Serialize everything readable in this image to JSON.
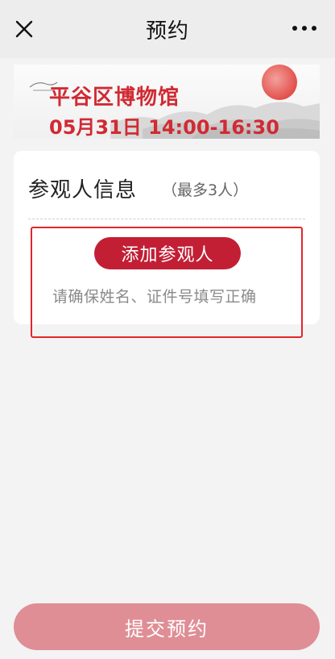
{
  "header": {
    "title": "预约",
    "close_icon": "close-icon",
    "more_icon": "more-icon"
  },
  "banner": {
    "museum_name": "平谷区博物馆",
    "date_time": "05月31日 14:00-16:30"
  },
  "visitor_card": {
    "heading": "参观人信息",
    "max_note": "（最多3人）",
    "add_button_label": "添加参观人",
    "hint": "请确保姓名、证件号填写正确"
  },
  "footer": {
    "submit_label": "提交预约"
  },
  "colors": {
    "accent": "#c21f35",
    "banner_text": "#d12a33",
    "submit_disabled": "#df8e96",
    "highlight": "#e3262b"
  }
}
